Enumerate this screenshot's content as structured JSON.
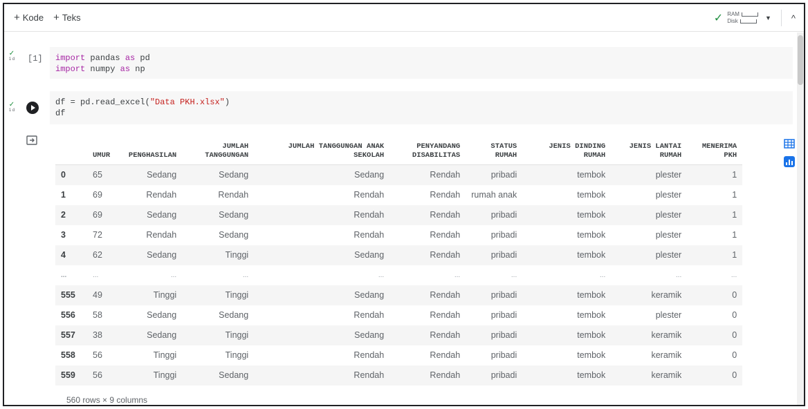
{
  "toolbar": {
    "add_code_label": "Kode",
    "add_text_label": "Teks",
    "ram_label": "RAM",
    "disk_label": "Disk"
  },
  "cells": [
    {
      "label": "[1]",
      "code_lines": [
        "import pandas as pd",
        "import numpy as np"
      ]
    },
    {
      "label": "",
      "code_lines": [
        "df = pd.read_excel(\"Data PKH.xlsx\")",
        "df"
      ]
    }
  ],
  "exec_time": "1 d",
  "table": {
    "columns": [
      "UMUR",
      "PENGHASILAN",
      "JUMLAH TANGGUNGAN",
      "JUMLAH TANGGUNGAN ANAK SEKOLAH",
      "PENYANDANG DISABILITAS",
      "STATUS RUMAH",
      "JENIS DINDING RUMAH",
      "JENIS LANTAI RUMAH",
      "MENERIMA PKH"
    ],
    "column_header_lines": [
      [
        "UMUR"
      ],
      [
        "PENGHASILAN"
      ],
      [
        "JUMLAH",
        "TANGGUNGAN"
      ],
      [
        "JUMLAH TANGGUNGAN ANAK",
        "SEKOLAH"
      ],
      [
        "PENYANDANG",
        "DISABILITAS"
      ],
      [
        "STATUS",
        "RUMAH"
      ],
      [
        "JENIS DINDING",
        "RUMAH"
      ],
      [
        "JENIS LANTAI",
        "RUMAH"
      ],
      [
        "MENERIMA",
        "PKH"
      ]
    ],
    "rows": [
      [
        "0",
        "65",
        "Sedang",
        "Sedang",
        "Sedang",
        "Rendah",
        "pribadi",
        "tembok",
        "plester",
        "1"
      ],
      [
        "1",
        "69",
        "Rendah",
        "Rendah",
        "Rendah",
        "Rendah",
        "rumah anak",
        "tembok",
        "plester",
        "1"
      ],
      [
        "2",
        "69",
        "Sedang",
        "Sedang",
        "Rendah",
        "Rendah",
        "pribadi",
        "tembok",
        "plester",
        "1"
      ],
      [
        "3",
        "72",
        "Rendah",
        "Sedang",
        "Rendah",
        "Rendah",
        "pribadi",
        "tembok",
        "plester",
        "1"
      ],
      [
        "4",
        "62",
        "Sedang",
        "Tinggi",
        "Sedang",
        "Rendah",
        "pribadi",
        "tembok",
        "plester",
        "1"
      ],
      [
        "...",
        "...",
        "...",
        "...",
        "...",
        "...",
        "...",
        "...",
        "...",
        "..."
      ],
      [
        "555",
        "49",
        "Tinggi",
        "Tinggi",
        "Sedang",
        "Rendah",
        "pribadi",
        "tembok",
        "keramik",
        "0"
      ],
      [
        "556",
        "58",
        "Sedang",
        "Sedang",
        "Rendah",
        "Rendah",
        "pribadi",
        "tembok",
        "plester",
        "0"
      ],
      [
        "557",
        "38",
        "Sedang",
        "Tinggi",
        "Sedang",
        "Rendah",
        "pribadi",
        "tembok",
        "keramik",
        "0"
      ],
      [
        "558",
        "56",
        "Tinggi",
        "Tinggi",
        "Rendah",
        "Rendah",
        "pribadi",
        "tembok",
        "keramik",
        "0"
      ],
      [
        "559",
        "56",
        "Tinggi",
        "Sedang",
        "Rendah",
        "Rendah",
        "pribadi",
        "tembok",
        "keramik",
        "0"
      ]
    ],
    "shape_text": "560 rows × 9 columns"
  },
  "colors": {
    "accent": "#1a73e8",
    "success": "#1e8e3e"
  },
  "icons": [
    "check-icon",
    "chevron-down-icon",
    "chevron-up-icon",
    "run-icon",
    "output-icon",
    "table-icon",
    "chart-icon"
  ]
}
